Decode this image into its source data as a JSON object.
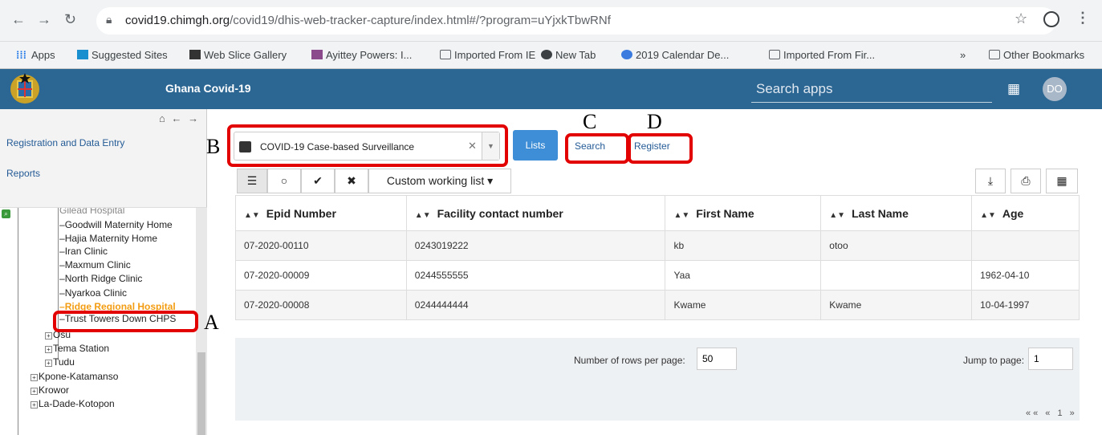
{
  "browser": {
    "url_host": "covid19.chimgh.org",
    "url_path": "/covid19/dhis-web-tracker-capture/index.html#/?program=uYjxkTbwRNf",
    "bookmarks": [
      {
        "label": "Apps"
      },
      {
        "label": "Suggested Sites"
      },
      {
        "label": "Web Slice Gallery"
      },
      {
        "label": "Ayittey Powers: I..."
      },
      {
        "label": "Imported From IE"
      },
      {
        "label": "New Tab"
      },
      {
        "label": "2019 Calendar De..."
      },
      {
        "label": "Imported From Fir..."
      },
      {
        "label": "»"
      },
      {
        "label": "Other Bookmarks"
      }
    ]
  },
  "app": {
    "title": "Ghana Covid-19",
    "search_placeholder": "Search apps",
    "avatar_initials": "DO"
  },
  "sidebar": {
    "registration_link": "Registration and Data Entry",
    "reports_link": "Reports",
    "tree": [
      {
        "label": "Gilead Hospital"
      },
      {
        "label": "Goodwill Maternity Home"
      },
      {
        "label": "Hajia Maternity Home"
      },
      {
        "label": "Iran Clinic"
      },
      {
        "label": "Maxmum Clinic"
      },
      {
        "label": "North Ridge Clinic"
      },
      {
        "label": "Nyarkoa Clinic"
      },
      {
        "label": "Ridge Regional Hospital"
      },
      {
        "label": "Trust Towers Down CHPS"
      },
      {
        "label": "Osu"
      },
      {
        "label": "Tema Station"
      },
      {
        "label": "Tudu"
      },
      {
        "label": "Kpone-Katamanso"
      },
      {
        "label": "Krowor"
      },
      {
        "label": "La-Dade-Kotopon"
      }
    ]
  },
  "main": {
    "program_selected": "COVID-19 Case-based Surveillance",
    "lists_label": "Lists",
    "search_label": "Search",
    "register_label": "Register",
    "working_list_label": "Custom working list",
    "columns": [
      "Epid Number",
      "Facility contact number",
      "First Name",
      "Last Name",
      "Age"
    ],
    "rows": [
      [
        "07-2020-00110",
        "0243019222",
        "kb",
        "otoo",
        ""
      ],
      [
        "07-2020-00009",
        "0244555555",
        "Yaa",
        "",
        "1962-04-10"
      ],
      [
        "07-2020-00008",
        "0244444444",
        "Kwame",
        "Kwame",
        "10-04-1997"
      ]
    ],
    "rows_per_page_label": "Number of rows per page:",
    "rows_per_page": "50",
    "jump_label": "Jump to page:",
    "jump_value": "1",
    "pager_nav": "«« « 1 »"
  },
  "annotations": {
    "A": "A",
    "B": "B",
    "C": "C",
    "D": "D"
  },
  "colors": {
    "appbar": "#2c6693",
    "highlight": "#e30000",
    "selected": "#f39c12",
    "lists_button": "#3d8ed6"
  }
}
